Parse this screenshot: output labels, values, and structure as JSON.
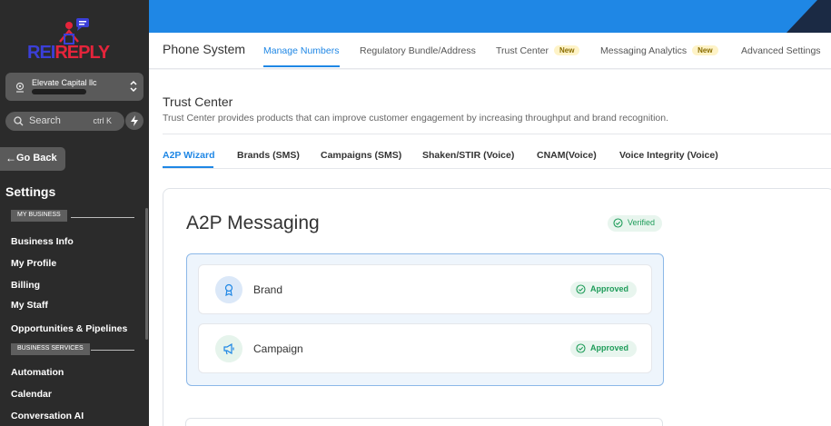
{
  "brand": {
    "logo_part1": "REI",
    "logo_part2": "REPLY"
  },
  "account": {
    "name": "Elevate Capital llc"
  },
  "search": {
    "placeholder": "Search",
    "shortcut": "ctrl K"
  },
  "sidebar": {
    "go_back": "Go Back",
    "settings_title": "Settings",
    "sections": [
      {
        "label": "MY BUSINESS"
      },
      {
        "label": "BUSINESS SERVICES"
      }
    ],
    "items": [
      {
        "label": "Business Info"
      },
      {
        "label": "My Profile"
      },
      {
        "label": "Billing"
      },
      {
        "label": "My Staff"
      },
      {
        "label": "Opportunities & Pipelines"
      },
      {
        "label": "Automation"
      },
      {
        "label": "Calendar"
      },
      {
        "label": "Conversation AI"
      }
    ]
  },
  "header": {
    "title": "Phone System",
    "tabs": [
      {
        "label": "Manage Numbers",
        "active": true
      },
      {
        "label": "Regulatory Bundle/Address"
      },
      {
        "label": "Trust Center",
        "badge": "New"
      },
      {
        "label": "Messaging Analytics",
        "badge": "New"
      },
      {
        "label": "Advanced Settings"
      }
    ]
  },
  "trust_center": {
    "title": "Trust Center",
    "description": "Trust Center provides products that can improve customer engagement by increasing throughput and brand recognition.",
    "tabs": [
      {
        "label": "A2P Wizard",
        "active": true
      },
      {
        "label": "Brands (SMS)"
      },
      {
        "label": "Campaigns (SMS)"
      },
      {
        "label": "Shaken/STIR (Voice)"
      },
      {
        "label": "CNAM(Voice)"
      },
      {
        "label": "Voice Integrity (Voice)"
      }
    ]
  },
  "a2p": {
    "title": "A2P Messaging",
    "status": "Verified",
    "rows": [
      {
        "label": "Brand",
        "status": "Approved",
        "icon": "award-icon"
      },
      {
        "label": "Campaign",
        "status": "Approved",
        "icon": "megaphone-icon"
      }
    ]
  },
  "colors": {
    "accent": "#1f87e5",
    "sidebar_bg": "#2b2b2b",
    "success": "#1f9d5a",
    "new_badge_bg": "#fef3c7"
  }
}
